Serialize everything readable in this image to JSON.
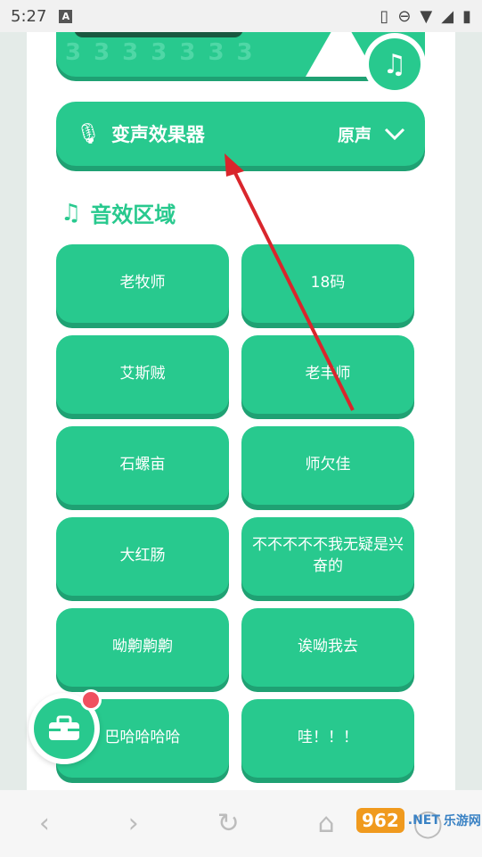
{
  "status": {
    "time": "5:27",
    "a_badge": "A"
  },
  "voice": {
    "title": "变声效果器",
    "selected": "原声"
  },
  "section": {
    "title": "音效区域"
  },
  "sounds": [
    "老牧师",
    "18码",
    "艾斯贼",
    "老丰师",
    "石螺亩",
    "师欠佳",
    "大红肠",
    "不不不不不我无疑是兴奋的",
    "呦齁齁齁",
    "诶呦我去",
    "巴哈哈哈哈",
    "哇！！！"
  ],
  "watermark": {
    "brand": "962",
    "net": ".NET",
    "site": "乐游网"
  },
  "colors": {
    "accent": "#28c98e",
    "accent_shadow": "#1fa173",
    "badge": "#f0505f"
  }
}
